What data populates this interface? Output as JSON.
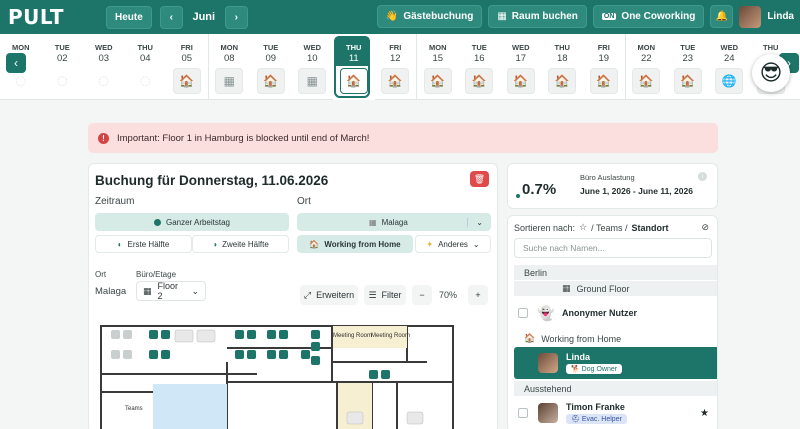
{
  "topbar": {
    "logo": "PULT",
    "today_label": "Heute",
    "month_label": "Juni",
    "prev_arrow": "‹",
    "next_arrow": "›",
    "guest_booking_label": "Gästebuchung",
    "room_booking_label": "Raum buchen",
    "coworking_label": "One Coworking",
    "user_name": "Linda"
  },
  "days": [
    {
      "wd": "MON",
      "dn": "01",
      "icon": "blank"
    },
    {
      "wd": "TUE",
      "dn": "02",
      "icon": "blank"
    },
    {
      "wd": "WED",
      "dn": "03",
      "icon": "blank"
    },
    {
      "wd": "THU",
      "dn": "04",
      "icon": "blank"
    },
    {
      "wd": "FRI",
      "dn": "05",
      "icon": "home"
    },
    {
      "wd": "MON",
      "dn": "08",
      "icon": "office"
    },
    {
      "wd": "TUE",
      "dn": "09",
      "icon": "home"
    },
    {
      "wd": "WED",
      "dn": "10",
      "icon": "office"
    },
    {
      "wd": "THU",
      "dn": "11",
      "icon": "home",
      "selected": true
    },
    {
      "wd": "FRI",
      "dn": "12",
      "icon": "home-repeat"
    },
    {
      "wd": "MON",
      "dn": "15",
      "icon": "home-repeat"
    },
    {
      "wd": "TUE",
      "dn": "16",
      "icon": "home-repeat"
    },
    {
      "wd": "WED",
      "dn": "17",
      "icon": "home-repeat"
    },
    {
      "wd": "THU",
      "dn": "18",
      "icon": "home-repeat"
    },
    {
      "wd": "FRI",
      "dn": "19",
      "icon": "home-repeat"
    },
    {
      "wd": "MON",
      "dn": "22",
      "icon": "home-repeat"
    },
    {
      "wd": "TUE",
      "dn": "23",
      "icon": "home-repeat"
    },
    {
      "wd": "WED",
      "dn": "24",
      "icon": "globe"
    },
    {
      "wd": "THU",
      "dn": "25",
      "icon": "home-repeat"
    }
  ],
  "alert": {
    "text": "Important: Floor 1 in Hamburg is blocked until end of March!"
  },
  "booking": {
    "title": "Buchung für Donnerstag, 11.06.2026",
    "zeitraum_label": "Zeitraum",
    "ort_label": "Ort",
    "full_day": "Ganzer Arbeitstag",
    "first_half": "Erste Hälfte",
    "second_half": "Zweite Hälfte",
    "location_select": "Malaga",
    "wfh": "Working from Home",
    "other": "Anderes",
    "ort_small_label": "Ort",
    "office_floor_label": "Büro/Etage",
    "ort_value": "Malaga",
    "floor_select": "Floor 2",
    "expand_label": "Erweitern",
    "filter_label": "Filter",
    "zoom": "70%",
    "zoom_minus": "−",
    "zoom_plus": "+",
    "room_label_1": "Meeting Room",
    "room_label_2": "Meeting Room",
    "room_label_3": "Teams"
  },
  "utilization": {
    "percent": "0.7%",
    "title": "Büro Auslastung",
    "range": "June 1, 2026 - June 11, 2026"
  },
  "people": {
    "sort_prefix": "Sortieren nach:",
    "sort_teams": "/ Teams /",
    "sort_location": "Standort",
    "search_placeholder": "Suche nach Namen...",
    "group_berlin": "Berlin",
    "group_ground_floor": "Ground Floor",
    "anon_name": "Anonymer Nutzer",
    "group_wfh": "Working from Home",
    "linda_name": "Linda",
    "linda_badge": "Dog Owner",
    "group_pending": "Ausstehend",
    "timon_name": "Timon Franke",
    "timon_badge": "Evac. Helper"
  },
  "colors": {
    "brand": "#1d7468",
    "alert_bg": "#fbdede",
    "danger": "#e04a4a"
  }
}
